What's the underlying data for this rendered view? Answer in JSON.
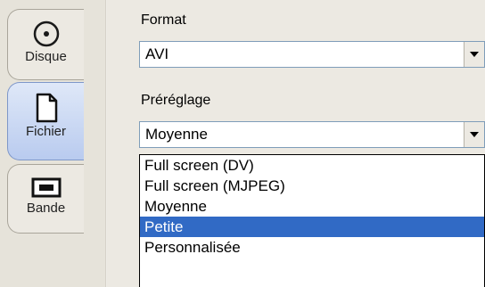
{
  "sidebar": {
    "tabs": [
      {
        "label": "Disque",
        "icon": "disc-icon"
      },
      {
        "label": "Fichier",
        "icon": "file-icon",
        "active": true
      },
      {
        "label": "Bande",
        "icon": "tape-icon"
      }
    ]
  },
  "format": {
    "label": "Format",
    "value": "AVI"
  },
  "preset": {
    "label": "Préréglage",
    "value": "Moyenne",
    "options": [
      "Full screen (DV)",
      "Full screen (MJPEG)",
      "Moyenne",
      "Petite",
      "Personnalisée"
    ],
    "highlighted_option": "Petite"
  },
  "colors": {
    "selection": "#316ac5",
    "active_tab": "#b9cbef",
    "panel": "#ece9e2"
  }
}
